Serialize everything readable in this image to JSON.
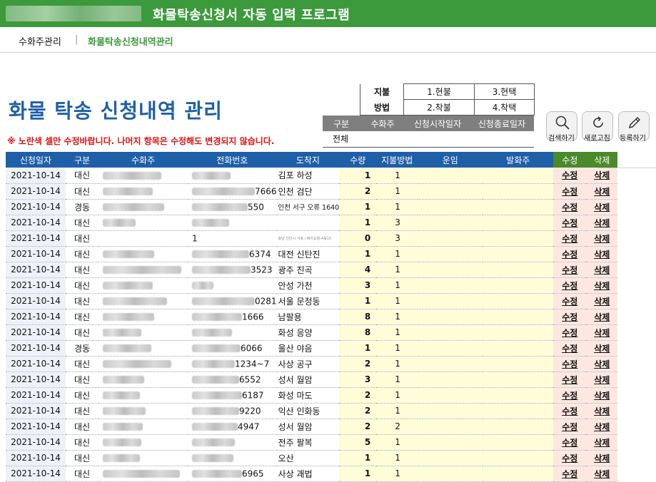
{
  "titlebar": {
    "title": "화물탁송신청서 자동 입력 프로그램"
  },
  "nav": {
    "item1": "수화주관리",
    "separator": "|",
    "item2": "화물탁송신청내역관리"
  },
  "heading": {
    "title": "화물 탁송 신청내역 관리",
    "notice": "※ 노란색 셀만 수정바랍니다. 나머지 항목은 수정해도 변경되지 않습니다."
  },
  "pay_legend": {
    "label1": "지불",
    "label2": "방법",
    "opt1": "1.현불",
    "opt2": "2.착불",
    "opt3": "3.현택",
    "opt4": "4.착택"
  },
  "filter": {
    "headers": [
      "구분",
      "수화주",
      "신청시작일자",
      "신청종료일자"
    ],
    "value": "전체"
  },
  "toolbar": {
    "search_label": "검색하기",
    "refresh_label": "새로고침",
    "register_label": "등록하기"
  },
  "grid": {
    "headers": [
      "신청일자",
      "구분",
      "수화주",
      "전화번호",
      "도착지",
      "수량",
      "지불방법",
      "운임",
      "발화주",
      "수정",
      "삭제"
    ],
    "edit_label": "수정",
    "delete_label": "삭제",
    "rows": [
      {
        "date": "2021-10-14",
        "type": "대신",
        "phone_suffix": "",
        "dest": "김포 하성",
        "qty": "1",
        "pay": "1",
        "dest_size": ""
      },
      {
        "date": "2021-10-14",
        "type": "대신",
        "phone_suffix": "7666",
        "dest": "인천 검단",
        "qty": "2",
        "pay": "1",
        "dest_size": ""
      },
      {
        "date": "2021-10-14",
        "type": "경동",
        "phone_suffix": "550",
        "dest": "인천 서구 오류 1640",
        "qty": "1",
        "pay": "1",
        "dest_size": "small"
      },
      {
        "date": "2021-10-14",
        "type": "대신",
        "phone_suffix": "",
        "dest": "",
        "qty": "1",
        "pay": "3",
        "dest_size": ""
      },
      {
        "date": "2021-10-14",
        "type": "대신",
        "phone_suffix": "1",
        "dest": "충남 천안시 서북 / 배차요청 A동15",
        "qty": "0",
        "pay": "3",
        "dest_size": "tiny"
      },
      {
        "date": "2021-10-14",
        "type": "대신",
        "phone_suffix": "6374",
        "dest": "대전 신탄진",
        "qty": "1",
        "pay": "1",
        "dest_size": ""
      },
      {
        "date": "2021-10-14",
        "type": "대신",
        "phone_suffix": "3523",
        "dest": "광주 진곡",
        "qty": "4",
        "pay": "1",
        "dest_size": ""
      },
      {
        "date": "2021-10-14",
        "type": "대신",
        "phone_suffix": "",
        "dest": "안성 가천",
        "qty": "3",
        "pay": "1",
        "dest_size": ""
      },
      {
        "date": "2021-10-14",
        "type": "대신",
        "phone_suffix": "0281",
        "dest": "서울 문정동",
        "qty": "1",
        "pay": "1",
        "dest_size": ""
      },
      {
        "date": "2021-10-14",
        "type": "대신",
        "phone_suffix": "1666",
        "dest": "남팔용",
        "qty": "8",
        "pay": "1",
        "dest_size": ""
      },
      {
        "date": "2021-10-14",
        "type": "대신",
        "phone_suffix": "",
        "dest": "화성 응양",
        "qty": "8",
        "pay": "1",
        "dest_size": ""
      },
      {
        "date": "2021-10-14",
        "type": "경동",
        "phone_suffix": "6066",
        "dest": "울산 야음",
        "qty": "1",
        "pay": "1",
        "dest_size": ""
      },
      {
        "date": "2021-10-14",
        "type": "대신",
        "phone_suffix": "1234~7",
        "dest": "사상 공구",
        "qty": "2",
        "pay": "1",
        "dest_size": ""
      },
      {
        "date": "2021-10-14",
        "type": "대신",
        "phone_suffix": "6552",
        "dest": "성서 월암",
        "qty": "3",
        "pay": "1",
        "dest_size": ""
      },
      {
        "date": "2021-10-14",
        "type": "대신",
        "phone_suffix": "6187",
        "dest": "화성 마도",
        "qty": "2",
        "pay": "1",
        "dest_size": ""
      },
      {
        "date": "2021-10-14",
        "type": "대신",
        "phone_suffix": "9220",
        "dest": "익산 인화동",
        "qty": "2",
        "pay": "1",
        "dest_size": ""
      },
      {
        "date": "2021-10-14",
        "type": "대신",
        "phone_suffix": "4947",
        "dest": "성서 월암",
        "qty": "2",
        "pay": "2",
        "dest_size": ""
      },
      {
        "date": "2021-10-14",
        "type": "대신",
        "phone_suffix": "",
        "dest": "전주 팔복",
        "qty": "5",
        "pay": "1",
        "dest_size": ""
      },
      {
        "date": "2021-10-14",
        "type": "대신",
        "phone_suffix": "",
        "dest": "오산",
        "qty": "1",
        "pay": "1",
        "dest_size": ""
      },
      {
        "date": "2021-10-14",
        "type": "대신",
        "phone_suffix": "6965",
        "dest": "사상 괘법",
        "qty": "1",
        "pay": "1",
        "dest_size": ""
      }
    ]
  }
}
